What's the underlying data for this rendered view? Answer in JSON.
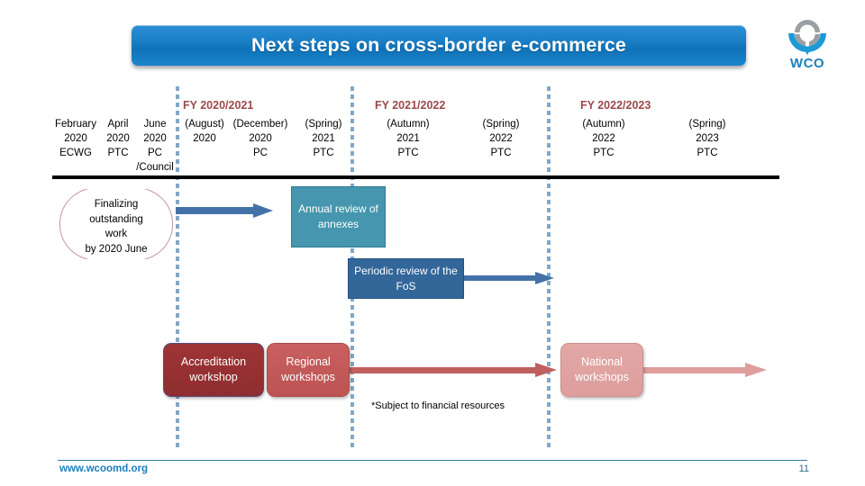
{
  "slide": {
    "title": "Next steps on cross-border e-commerce",
    "logo": {
      "name": "wco-logo",
      "text": "WCO"
    },
    "footnote": "*Subject to financial resources",
    "footer": {
      "url": "www.wcoomd.org",
      "page_number": "11"
    },
    "colors": {
      "title_banner": "#1a7fc6",
      "fy_label": "#9b4a4a",
      "timeline_bar": "#000000",
      "separator": "#7fa8cc",
      "annual_box": "#4596ae",
      "periodic_box": "#336699",
      "accreditation_box": "#9e3436",
      "regional_box": "#c9605f",
      "national_box": "#e2a8a6",
      "blue_arrow": "#4472a8",
      "red_arrow": "#c0605e",
      "pink_arrow": "#dd9e9c",
      "footer_link": "#1b7fbd"
    }
  },
  "fiscal_years": [
    {
      "label": "FY 2020/2021"
    },
    {
      "label": "FY 2021/2022"
    },
    {
      "label": "FY 2022/2023"
    }
  ],
  "milestones": [
    {
      "period": "February",
      "year": "2020",
      "body": "ECWG"
    },
    {
      "period": "April",
      "year": "2020",
      "body": "PTC"
    },
    {
      "period": "June",
      "year": "2020",
      "body": "PC",
      "body2": "/Council"
    },
    {
      "period": "(August)",
      "year": "2020",
      "body": ""
    },
    {
      "period": "(December)",
      "year": "2020",
      "body": "PC"
    },
    {
      "period": "(Spring)",
      "year": "2021",
      "body": "PTC"
    },
    {
      "period": "(Autumn)",
      "year": "2021",
      "body": "PTC"
    },
    {
      "period": "(Spring)",
      "year": "2022",
      "body": "PTC"
    },
    {
      "period": "(Autumn)",
      "year": "2022",
      "body": "PTC"
    },
    {
      "period": "(Spring)",
      "year": "2023",
      "body": "PTC"
    }
  ],
  "bracket": {
    "line1": "Finalizing",
    "line2": "outstanding",
    "line3": "work",
    "line4": "by 2020 June"
  },
  "boxes": {
    "annual_review": "Annual review of annexes",
    "periodic_review": "Periodic review of the FoS",
    "accreditation_workshop": "Accreditation workshop",
    "regional_workshops": "Regional workshops",
    "national_workshops": "National workshops"
  }
}
